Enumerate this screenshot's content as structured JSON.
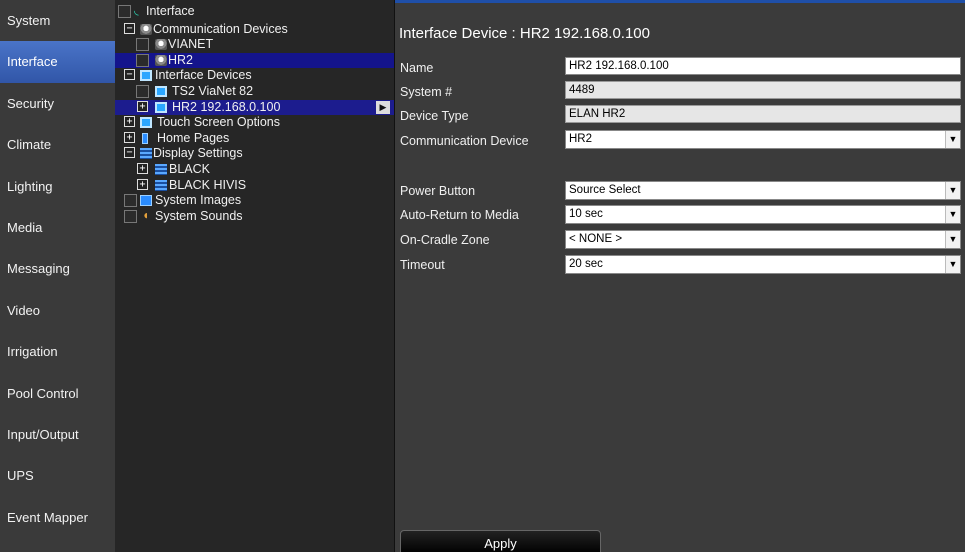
{
  "nav": {
    "items": [
      {
        "label": "System"
      },
      {
        "label": "Interface"
      },
      {
        "label": "Security"
      },
      {
        "label": "Climate"
      },
      {
        "label": "Lighting"
      },
      {
        "label": "Media"
      },
      {
        "label": "Messaging"
      },
      {
        "label": "Video"
      },
      {
        "label": "Irrigation"
      },
      {
        "label": "Pool Control"
      },
      {
        "label": "Input/Output"
      },
      {
        "label": "UPS"
      },
      {
        "label": "Event Mapper"
      }
    ],
    "active": "Interface",
    "active_color": "#3a64bc"
  },
  "tree": {
    "interface": "Interface",
    "comm_devices": "Communication Devices",
    "vianet": "VIANET",
    "hr2": "HR2",
    "interface_devices": "Interface Devices",
    "ts2": "TS2 ViaNet 82",
    "hr2_ip": "HR2 192.168.0.100",
    "touch_screen_options": "Touch Screen Options",
    "home_pages": "Home Pages",
    "display_settings": "Display Settings",
    "black": "BLACK",
    "black_hivis": "BLACK HIVIS",
    "system_images": "System Images",
    "system_sounds": "System Sounds",
    "expand_minus": "−",
    "expand_plus": "+",
    "arrow": "▶"
  },
  "main": {
    "title": "Interface Device : HR2 192.168.0.100",
    "fields": {
      "name_label": "Name",
      "name_value": "HR2 192.168.0.100",
      "system_label": "System #",
      "system_value": "4489",
      "type_label": "Device Type",
      "type_value": "ELAN HR2",
      "comm_label": "Communication Device",
      "comm_value": "HR2",
      "power_label": "Power Button",
      "power_value": "Source Select",
      "autoreturn_label": "Auto-Return to Media",
      "autoreturn_value": "10 sec",
      "cradle_label": "On-Cradle Zone",
      "cradle_value": "< NONE >",
      "timeout_label": "Timeout",
      "timeout_value": "20 sec",
      "dropdown_glyph": "▼"
    },
    "apply_label": "Apply"
  }
}
